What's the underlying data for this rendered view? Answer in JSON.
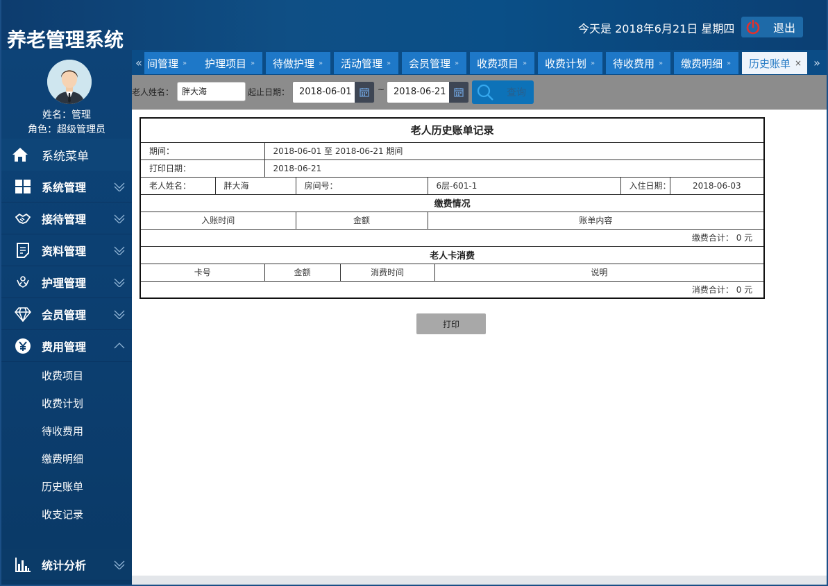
{
  "header": {
    "app_title": "养老管理系统",
    "date_text": "今天是 2018年6月21日 星期四",
    "logout_label": "退出"
  },
  "profile": {
    "name_line": "姓名：管理",
    "role_line": "角色：超级管理员"
  },
  "sidebar": {
    "menu_title": "系统菜单",
    "items": [
      {
        "label": "系统管理",
        "icon": "windows-grid-icon"
      },
      {
        "label": "接待管理",
        "icon": "handshake-icon"
      },
      {
        "label": "资料管理",
        "icon": "document-icon"
      },
      {
        "label": "护理管理",
        "icon": "hands-care-icon"
      },
      {
        "label": "会员管理",
        "icon": "diamond-icon"
      },
      {
        "label": "费用管理",
        "icon": "yen-icon"
      }
    ],
    "sub_items": [
      "收费项目",
      "收费计划",
      "待收费用",
      "缴费明细",
      "历史账单",
      "收支记录"
    ],
    "stats_label": "统计分析"
  },
  "tabs": {
    "items": [
      "间管理",
      "护理项目",
      "待做护理",
      "活动管理",
      "会员管理",
      "收费项目",
      "收费计划",
      "待收费用",
      "缴费明细",
      "历史账单"
    ],
    "close_glyph": "»",
    "active_close_glyph": "×",
    "prev_glyph": "«",
    "next_glyph": "»"
  },
  "filter": {
    "name_label": "老人姓名：",
    "name_value": "胖大海",
    "date_label": "起止日期：",
    "start_date": "2018-06-01",
    "date_sep": "~",
    "end_date": "2018-06-21",
    "search_label": "查询"
  },
  "report": {
    "title": "老人历史账单记录",
    "period_label": "期间：",
    "period_value": "2018-06-01 至 2018-06-21 期间",
    "print_date_label": "打印日期：",
    "print_date_value": "2018-06-21",
    "elder_name_label": "老人姓名：",
    "elder_name_value": "胖大海",
    "room_label": "房间号：",
    "room_value": "6层-601-1",
    "checkin_label": "入住日期：",
    "checkin_value": "2018-06-03",
    "payment_section": "缴费情况",
    "payment_cols": [
      "入账时间",
      "金额",
      "账单内容"
    ],
    "payment_total": "缴费合计： 0 元",
    "card_section": "老人卡消费",
    "card_cols": [
      "卡号",
      "金额",
      "消费时间",
      "说明"
    ],
    "card_total": "消费合计： 0 元",
    "print_button": "打印"
  }
}
